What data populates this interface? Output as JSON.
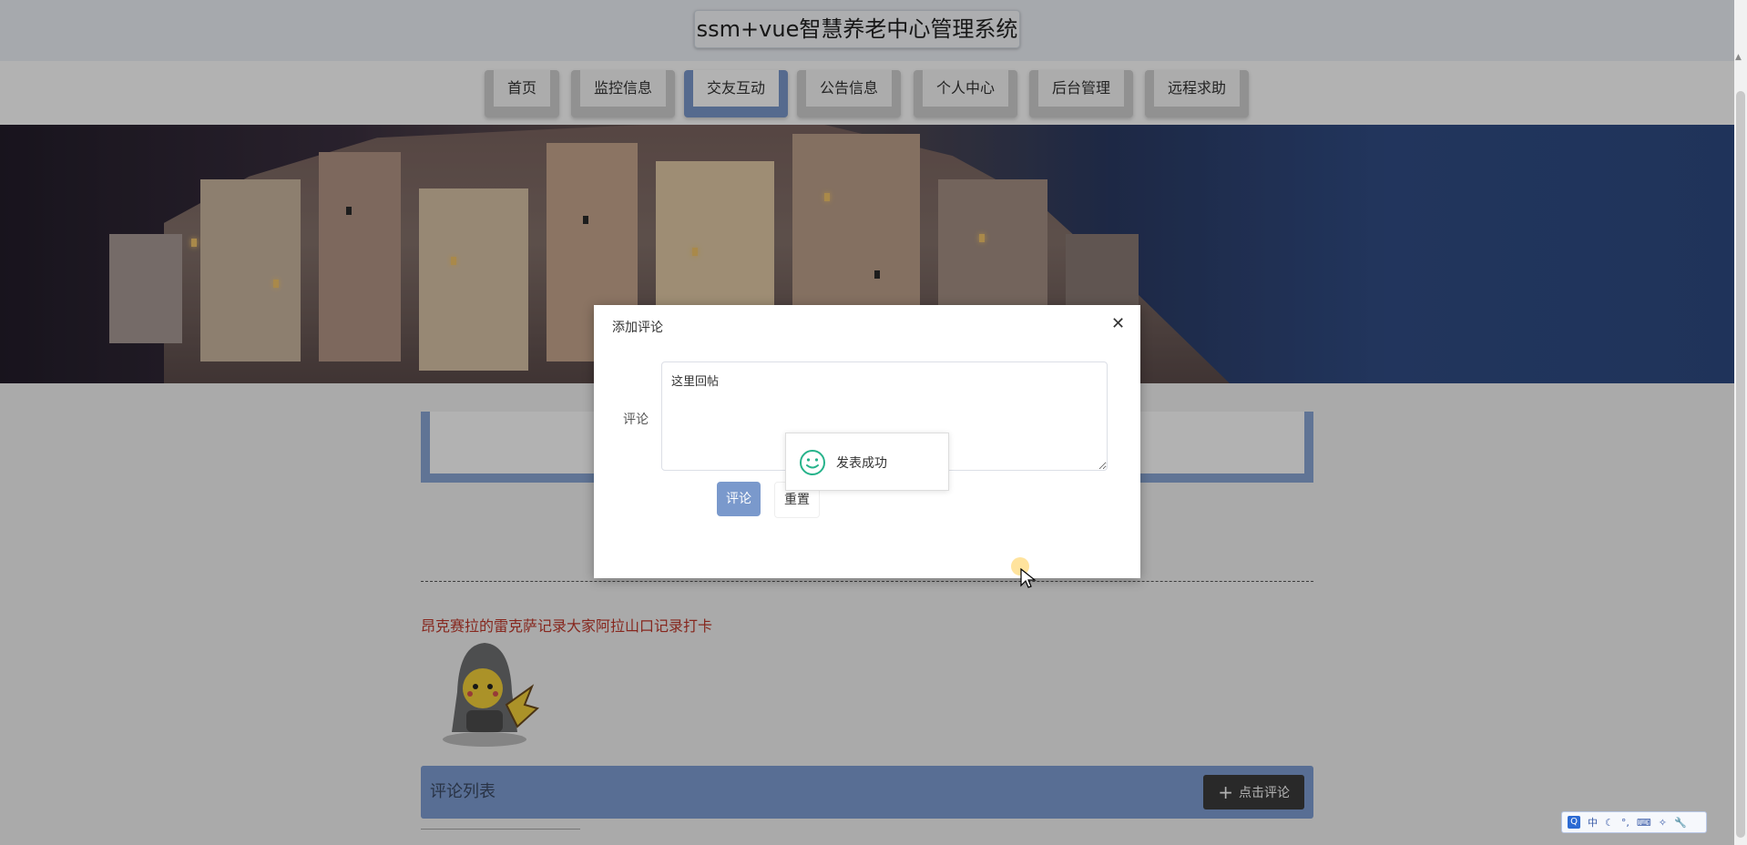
{
  "header": {
    "title": "ssm+vue智慧养老中心管理系统"
  },
  "nav": {
    "items": [
      {
        "label": "首页",
        "active": false
      },
      {
        "label": "监控信息",
        "active": false
      },
      {
        "label": "交友互动",
        "active": true
      },
      {
        "label": "公告信息",
        "active": false
      },
      {
        "label": "个人中心",
        "active": false
      },
      {
        "label": "后台管理",
        "active": false
      },
      {
        "label": "远程求助",
        "active": false
      }
    ]
  },
  "post": {
    "title": "昂克赛拉的雷克萨记录大家阿拉山口记录打卡"
  },
  "comments": {
    "title": "评论列表",
    "add_label": "点击评论"
  },
  "dialog": {
    "title": "添加评论",
    "field_label": "评论",
    "textarea_value": "这里回帖",
    "submit_label": "评论",
    "reset_label": "重置"
  },
  "toast": {
    "message": "发表成功"
  },
  "ime": {
    "mode": "中"
  },
  "colors": {
    "accent": "#7a99cc",
    "nav_bg": "#d0d0d0",
    "post_title": "#c0392b",
    "toast_icon": "#27b38b",
    "bar_dark": "#3c3c3c"
  }
}
